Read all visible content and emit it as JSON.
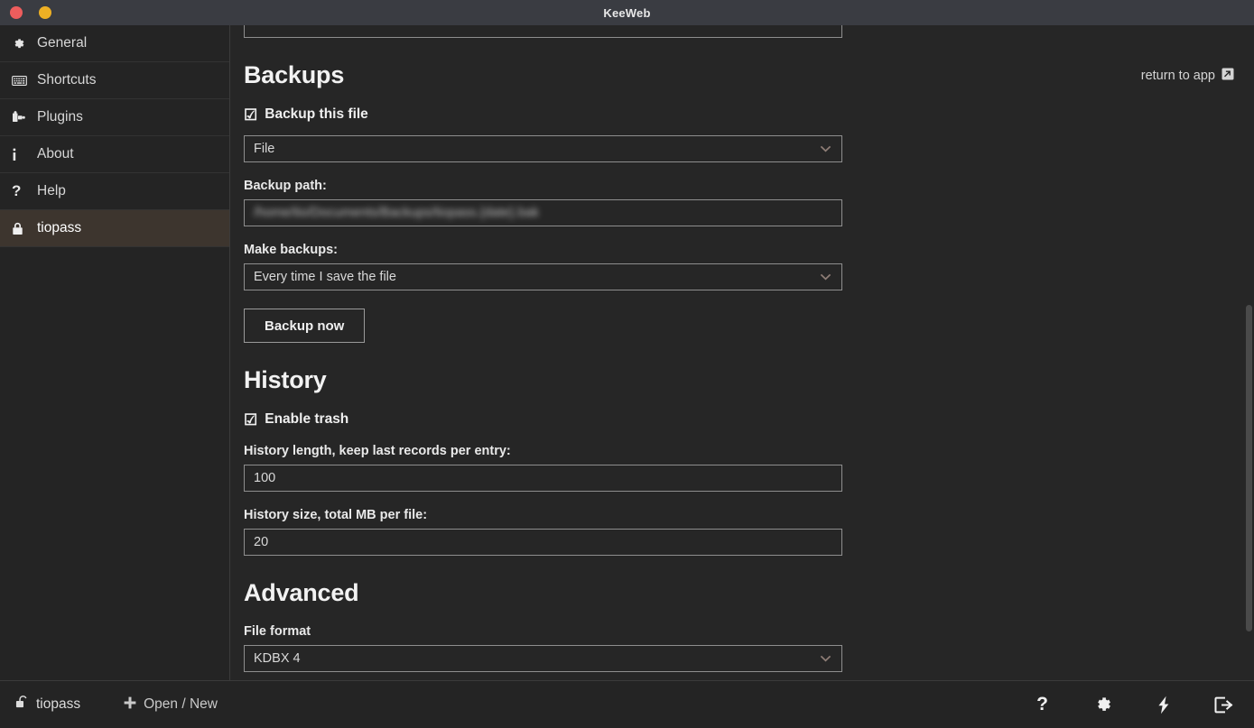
{
  "window": {
    "title": "KeeWeb",
    "controls": [
      {
        "name": "close",
        "color": "#ed5d5d"
      },
      {
        "name": "minimize",
        "color": "#eeb024"
      }
    ]
  },
  "sidebar": {
    "items": [
      {
        "label": "General",
        "icon": "gear-icon",
        "active": false
      },
      {
        "label": "Shortcuts",
        "icon": "keyboard-icon",
        "active": false
      },
      {
        "label": "Plugins",
        "icon": "plugin-icon",
        "active": false
      },
      {
        "label": "About",
        "icon": "info-icon",
        "active": false
      },
      {
        "label": "Help",
        "icon": "question-icon",
        "active": false
      },
      {
        "label": "tiopass",
        "icon": "lock-icon",
        "active": true
      }
    ]
  },
  "main": {
    "return_to_app": "return to app",
    "backups": {
      "heading": "Backups",
      "backup_this_file_label": "Backup this file",
      "backup_this_file_checked": true,
      "storage_select_value": "File",
      "backup_path_label": "Backup path:",
      "backup_path_value": "/home/tio/Documents/Backups/tiopass.{date}.bak",
      "make_backups_label": "Make backups:",
      "make_backups_value": "Every time I save the file",
      "backup_now_label": "Backup now"
    },
    "history": {
      "heading": "History",
      "enable_trash_label": "Enable trash",
      "enable_trash_checked": true,
      "history_length_label": "History length, keep last records per entry:",
      "history_length_value": "100",
      "history_size_label": "History size, total MB per file:",
      "history_size_value": "20"
    },
    "advanced": {
      "heading": "Advanced",
      "file_format_label": "File format",
      "file_format_value": "KDBX 4"
    }
  },
  "footer": {
    "open_file": "tiopass",
    "open_new": "Open / New",
    "icons": [
      {
        "name": "help-icon"
      },
      {
        "name": "settings-gear-icon"
      },
      {
        "name": "generate-bolt-icon"
      },
      {
        "name": "lock-exit-icon"
      }
    ]
  },
  "colors": {
    "window_chrome": "#3a3c42",
    "sidebar_bg": "#242424",
    "main_bg": "#262626",
    "active_item_bg": "#3d352e",
    "accent_close": "#ed5d5d",
    "accent_minimize": "#eeb024",
    "chevron": "#8e7d76"
  }
}
